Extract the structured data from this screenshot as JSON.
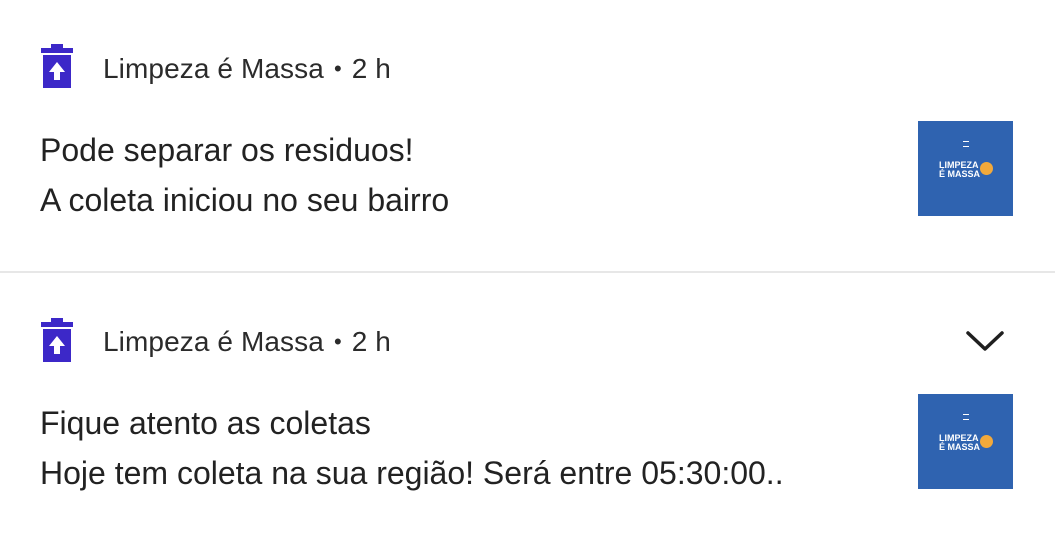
{
  "notifications": [
    {
      "app_name": "Limpeza é Massa",
      "separator": "•",
      "time": "2 h",
      "title": "Pode separar os residuos!",
      "body": "A coleta iniciou no seu bairro",
      "app_icon": "trash-upload-icon",
      "thumbnail_logo_line1": "LIMPEZA",
      "thumbnail_logo_line2": "É MASSA"
    },
    {
      "app_name": "Limpeza é Massa",
      "separator": "•",
      "time": "2 h",
      "title": "Fique atento as coletas",
      "body": "Hoje tem coleta na sua região! Será entre 05:30:00..",
      "app_icon": "trash-upload-icon",
      "thumbnail_logo_line1": "LIMPEZA",
      "thumbnail_logo_line2": "É MASSA",
      "expand_icon": "chevron-down-icon"
    }
  ],
  "colors": {
    "app_icon": "#3c28c8",
    "thumbnail_bg": "#2f63b0",
    "text": "#222222",
    "divider": "#e7e7e7"
  }
}
